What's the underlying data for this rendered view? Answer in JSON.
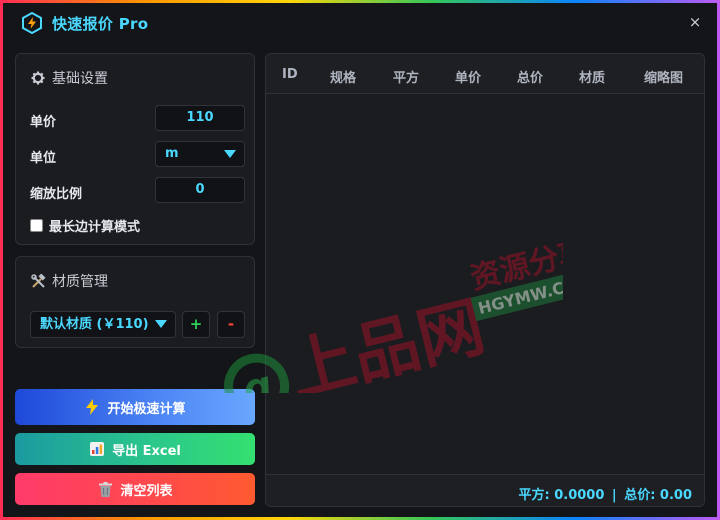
{
  "window": {
    "title": "快速报价 Pro",
    "close_glyph": "×",
    "logo_icon": "lightning-hexagon-icon"
  },
  "settings": {
    "heading": "基础设置",
    "heading_icon": "gear-icon",
    "unit_price_label": "单价",
    "unit_price_value": "110",
    "unit_label": "单位",
    "unit_value": "m",
    "scale_label": "缩放比例",
    "scale_value": "0",
    "longest_side_label": "最长边计算模式",
    "longest_side_checked": false
  },
  "material": {
    "heading": "材质管理",
    "heading_icon": "tools-icon",
    "selected": "默认材质 (￥110)",
    "add_label": "+",
    "remove_label": "-"
  },
  "actions": {
    "start_label": "开始极速计算",
    "start_icon": "lightning-icon",
    "export_label": "导出 Excel",
    "export_icon": "chart-icon",
    "clear_label": "清空列表",
    "clear_icon": "trash-icon"
  },
  "table": {
    "columns": [
      "ID",
      "规格",
      "平方",
      "单价",
      "总价",
      "材质",
      "缩略图"
    ],
    "rows": []
  },
  "summary": {
    "area_text": "平方: 0.0000",
    "separator": "|",
    "total_text": "总价: 0.00"
  },
  "watermark": {
    "main_text": "上品网",
    "side_text": "资源分享",
    "domain_text": "HGYMW.COM"
  },
  "colors": {
    "accent": "#4ad8ff",
    "background": "#141518",
    "panel": "#1b1c20",
    "add_green": "#30d158",
    "remove_red": "#ff453a"
  }
}
